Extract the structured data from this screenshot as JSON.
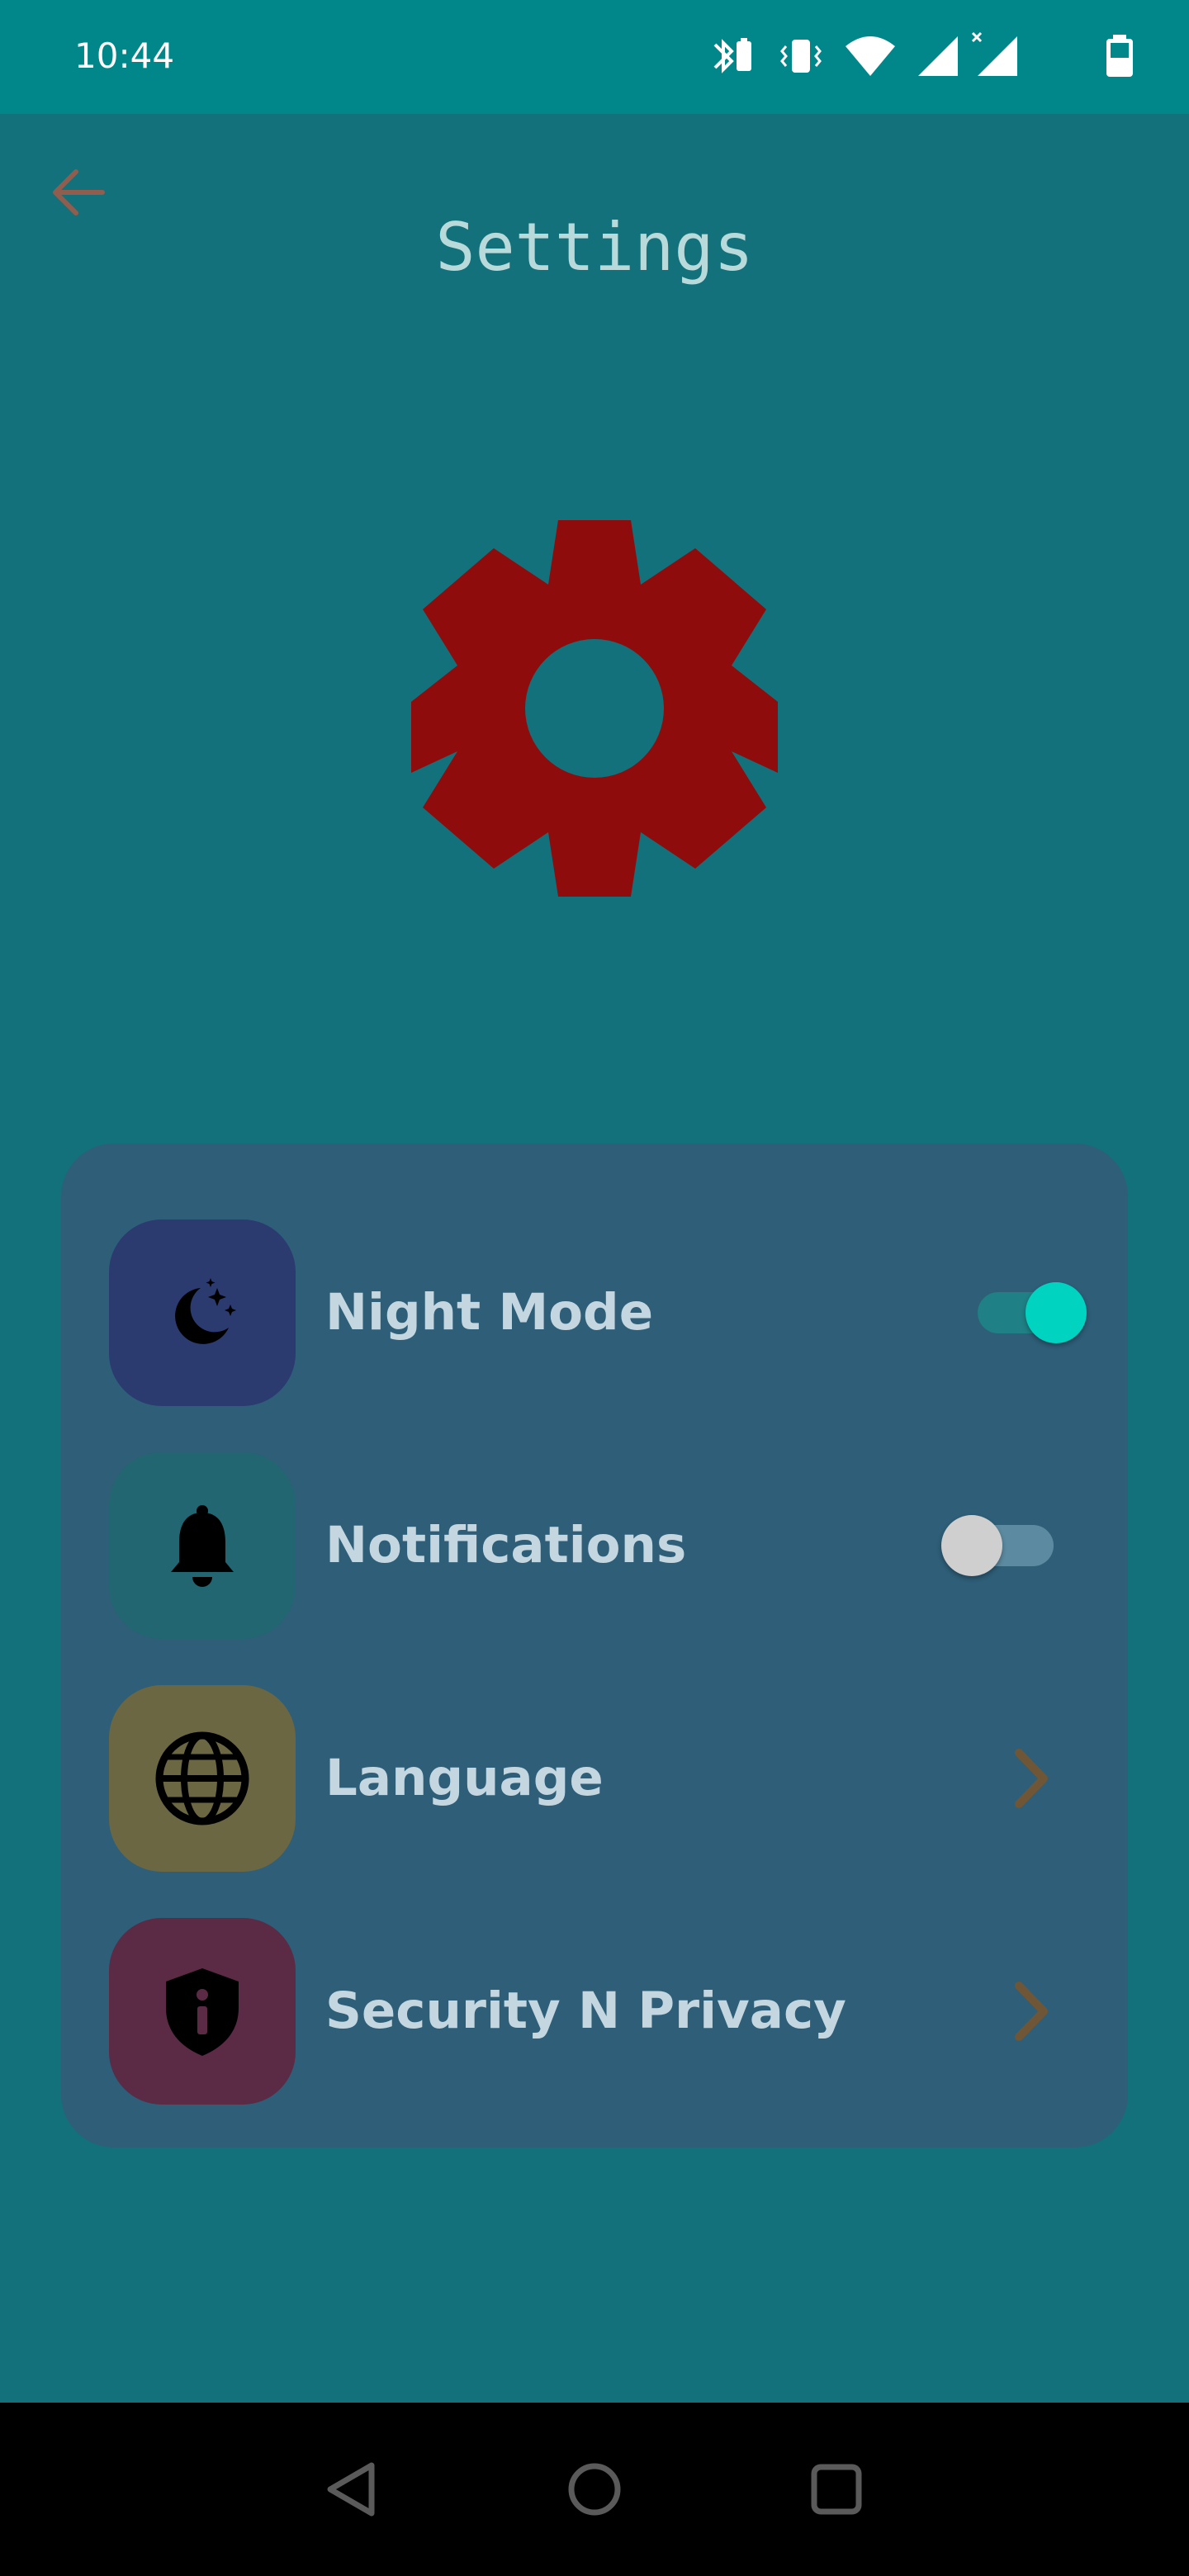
{
  "status_bar": {
    "time": "10:44",
    "icons": [
      "bluetooth-battery-icon",
      "vibrate-icon",
      "wifi-icon",
      "cell-signal-icon",
      "cell-signal-no-data-icon",
      "battery-icon"
    ]
  },
  "header": {
    "back_icon": "arrow-left-icon",
    "title": "Settings"
  },
  "hero": {
    "icon": "gear-icon",
    "color": "#8f0c0c"
  },
  "settings": {
    "items": [
      {
        "label": "Night Mode",
        "icon": "moon-stars-icon",
        "icon_bg": "#2b3a6f",
        "control": "toggle",
        "toggle_on": true
      },
      {
        "label": "Notifications",
        "icon": "bell-icon",
        "icon_bg": "#216670",
        "control": "toggle",
        "toggle_on": false
      },
      {
        "label": "Language",
        "icon": "globe-icon",
        "icon_bg": "#6c6743",
        "control": "chevron"
      },
      {
        "label": "Security N Privacy",
        "icon": "shield-info-icon",
        "icon_bg": "#5b2a45",
        "control": "chevron"
      }
    ]
  },
  "colors": {
    "background": "#13717b",
    "status_bar": "#01878a",
    "card": "#2e5e78",
    "toggle_on_thumb": "#00d3c0",
    "toggle_off_thumb": "#cfcfcf",
    "chevron": "#6f5636",
    "back_arrow": "#8f5e4f"
  },
  "nav_bar": {
    "icons": [
      "back-triangle-icon",
      "home-circle-icon",
      "recents-square-icon"
    ]
  }
}
